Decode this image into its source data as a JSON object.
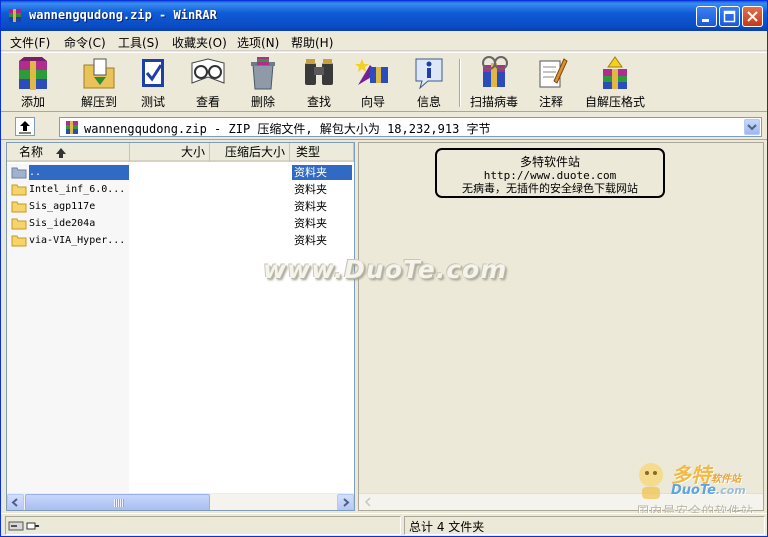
{
  "window": {
    "title": "wannengqudong.zip - WinRAR",
    "controls": [
      "minimize",
      "maximize",
      "close"
    ],
    "colors": {
      "titlebar": "#0A4CC4",
      "selection": "#316AC5",
      "face": "#ECE9D8"
    }
  },
  "menu": {
    "items": [
      {
        "label": "文件(F)"
      },
      {
        "label": "命令(C)"
      },
      {
        "label": "工具(S)"
      },
      {
        "label": "收藏夹(O)"
      },
      {
        "label": "选项(N)"
      },
      {
        "label": "帮助(H)"
      }
    ]
  },
  "toolbar": {
    "buttons": [
      {
        "label": "添加",
        "icon": "add-archive-icon"
      },
      {
        "label": "解压到",
        "icon": "extract-to-icon"
      },
      {
        "label": "测试",
        "icon": "test-icon"
      },
      {
        "label": "查看",
        "icon": "view-icon"
      },
      {
        "label": "删除",
        "icon": "delete-icon"
      },
      {
        "label": "查找",
        "icon": "find-icon"
      },
      {
        "label": "向导",
        "icon": "wizard-icon"
      },
      {
        "label": "信息",
        "icon": "info-icon"
      },
      {
        "label": "扫描病毒",
        "icon": "virus-scan-icon"
      },
      {
        "label": "注释",
        "icon": "comment-icon"
      },
      {
        "label": "自解压格式",
        "icon": "sfx-icon"
      }
    ]
  },
  "address": {
    "text": "wannengqudong.zip - ZIP 压缩文件, 解包大小为 18,232,913 字节"
  },
  "filelist": {
    "columns": [
      "名称",
      "大小",
      "压缩后大小",
      "类型"
    ],
    "rows": [
      {
        "name": "..",
        "type": "资料夹",
        "selected": true
      },
      {
        "name": "Intel_inf_6.0...",
        "type": "资料夹"
      },
      {
        "name": "Sis_agp117e",
        "type": "资料夹"
      },
      {
        "name": "Sis_ide204a",
        "type": "资料夹"
      },
      {
        "name": "via-VIA_Hyper...",
        "type": "资料夹"
      }
    ]
  },
  "comment": {
    "line1": "多特软件站",
    "line2": "http://www.duote.com",
    "line3": "无病毒，无插件的安全绿色下载网站"
  },
  "watermark": "www.DuoTe.com",
  "corner": {
    "brand": "多特",
    "brand_small": "软件站",
    "site": "DuoTe",
    "site_small": ".com",
    "tagline": "国内最安全的软件站"
  },
  "status": {
    "total": "总计 4 文件夹"
  }
}
